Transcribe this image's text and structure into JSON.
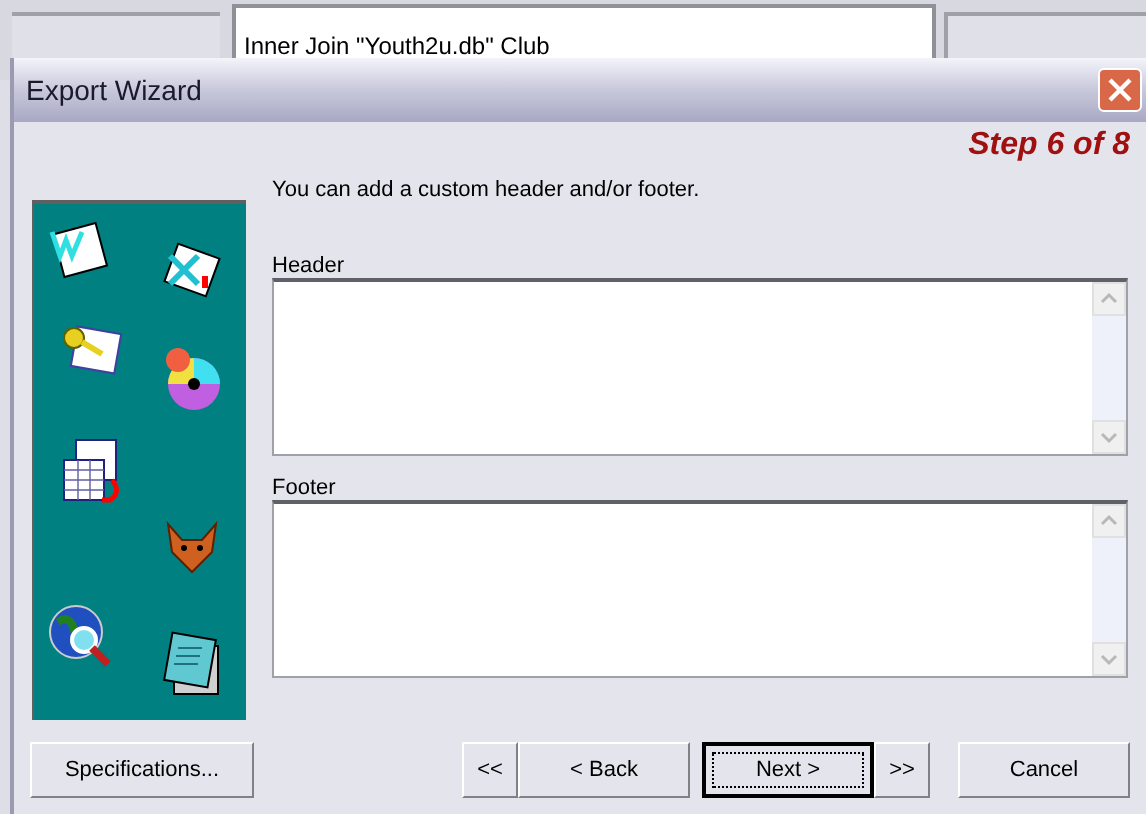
{
  "background_window": {
    "text": "Inner Join \"Youth2u.db\" Club"
  },
  "window": {
    "title": "Export Wizard",
    "step": "Step 6 of 8"
  },
  "instruction": "You can add a custom header and/or footer.",
  "fields": [
    {
      "label": "Header"
    },
    {
      "label": "Footer"
    }
  ],
  "buttons": [
    {
      "label": "Specifications...",
      "default": false
    },
    {
      "label": "<<",
      "default": false
    },
    {
      "label": "< Back",
      "default": false
    },
    {
      "label": "Next >",
      "default": true
    },
    {
      "label": ">>",
      "default": false
    },
    {
      "label": "Cancel",
      "default": false
    }
  ]
}
